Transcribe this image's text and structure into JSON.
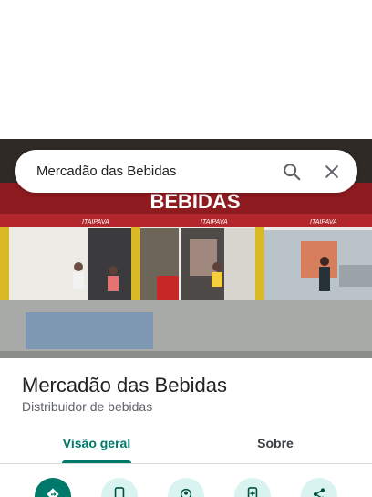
{
  "search": {
    "value": "Mercadão das Bebidas"
  },
  "icons": {
    "search": "search-icon",
    "close": "close-icon"
  },
  "photo": {
    "storefront_sign": "BEBIDAS",
    "banner_brand": "ITAIPAVA"
  },
  "place": {
    "name": "Mercadão das Bebidas",
    "category": "Distribuidor de bebidas"
  },
  "tabs": [
    {
      "label": "Visão geral",
      "selected": true
    },
    {
      "label": "Sobre",
      "selected": false
    }
  ],
  "actions": [
    {
      "icon": "directions-icon",
      "primary": true
    },
    {
      "icon": "phone-icon",
      "primary": false
    },
    {
      "icon": "nearby-icon",
      "primary": false
    },
    {
      "icon": "save-to-phone-icon",
      "primary": false
    },
    {
      "icon": "share-icon",
      "primary": false
    }
  ],
  "colors": {
    "accent": "#00796b",
    "action_bg": "#d8f3f0",
    "text_primary": "#202124",
    "text_secondary": "#5f6368"
  }
}
